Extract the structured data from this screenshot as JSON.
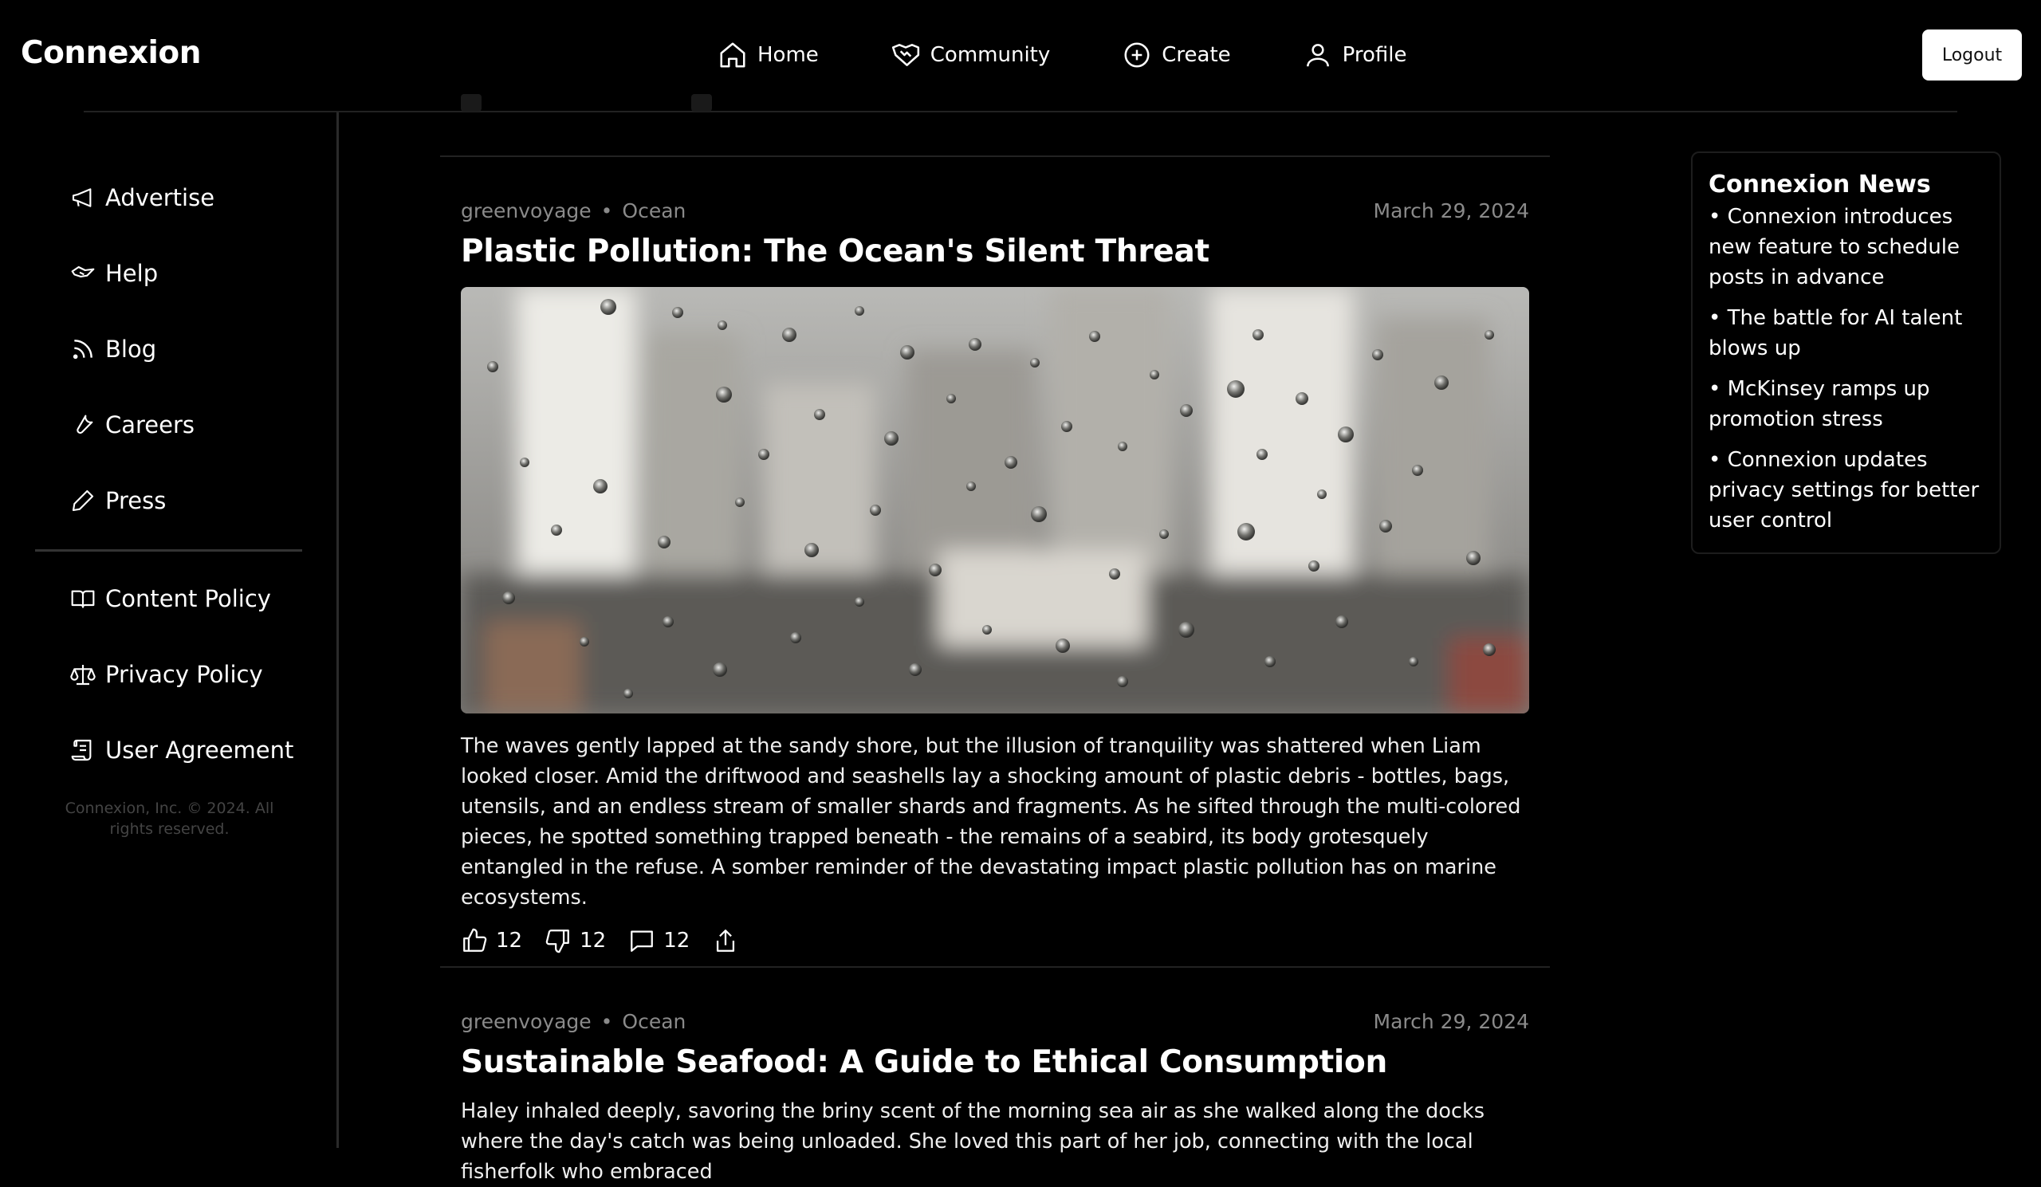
{
  "app": {
    "brand": "Connexion"
  },
  "nav": {
    "items": [
      {
        "label": "Home",
        "icon": "home-icon"
      },
      {
        "label": "Community",
        "icon": "handshake-icon"
      },
      {
        "label": "Create",
        "icon": "plus-circle-icon"
      },
      {
        "label": "Profile",
        "icon": "user-icon"
      }
    ],
    "logout_label": "Logout"
  },
  "sidebar": {
    "items": [
      {
        "label": "Advertise",
        "icon": "megaphone-icon"
      },
      {
        "label": "Help",
        "icon": "handshake-icon"
      },
      {
        "label": "Blog",
        "icon": "rss-icon"
      },
      {
        "label": "Careers",
        "icon": "wrench-icon"
      },
      {
        "label": "Press",
        "icon": "pen-icon"
      }
    ],
    "policy_items": [
      {
        "label": "Content Policy",
        "icon": "book-icon"
      },
      {
        "label": "Privacy Policy",
        "icon": "scale-icon"
      },
      {
        "label": "User Agreement",
        "icon": "scroll-icon"
      }
    ],
    "copyright": "Connexion, Inc. © 2024. All rights reserved."
  },
  "posts": [
    {
      "author": "greenvoyage",
      "community": "Ocean",
      "date": "March 29, 2024",
      "title": "Plastic Pollution: The Ocean's Silent Threat",
      "body": "The waves gently lapped at the sandy shore, but the illusion of tranquility was shattered when Liam looked closer. Amid the driftwood and seashells lay a shocking amount of plastic debris - bottles, bags, utensils, and an endless stream of smaller shards and fragments. As he sifted through the multi-colored pieces, he spotted something trapped beneath - the remains of a seabird, its body grotesquely entangled in the refuse. A somber reminder of the devastating impact plastic pollution has on marine ecosystems.",
      "likes": "12",
      "dislikes": "12",
      "comments": "12"
    },
    {
      "author": "greenvoyage",
      "community": "Ocean",
      "date": "March 29, 2024",
      "title": "Sustainable Seafood: A Guide to Ethical Consumption",
      "body": "Haley inhaled deeply, savoring the briny scent of the morning sea air as she walked along the docks where the day's catch was being unloaded. She loved this part of her job, connecting with the local fisherfolk who embraced"
    }
  ],
  "news": {
    "title": "Connexion News",
    "items": [
      "Connexion introduces new feature to schedule posts in advance",
      "The battle for AI talent blows up",
      "McKinsey ramps up promotion stress",
      "Connexion updates privacy settings for better user control"
    ]
  }
}
